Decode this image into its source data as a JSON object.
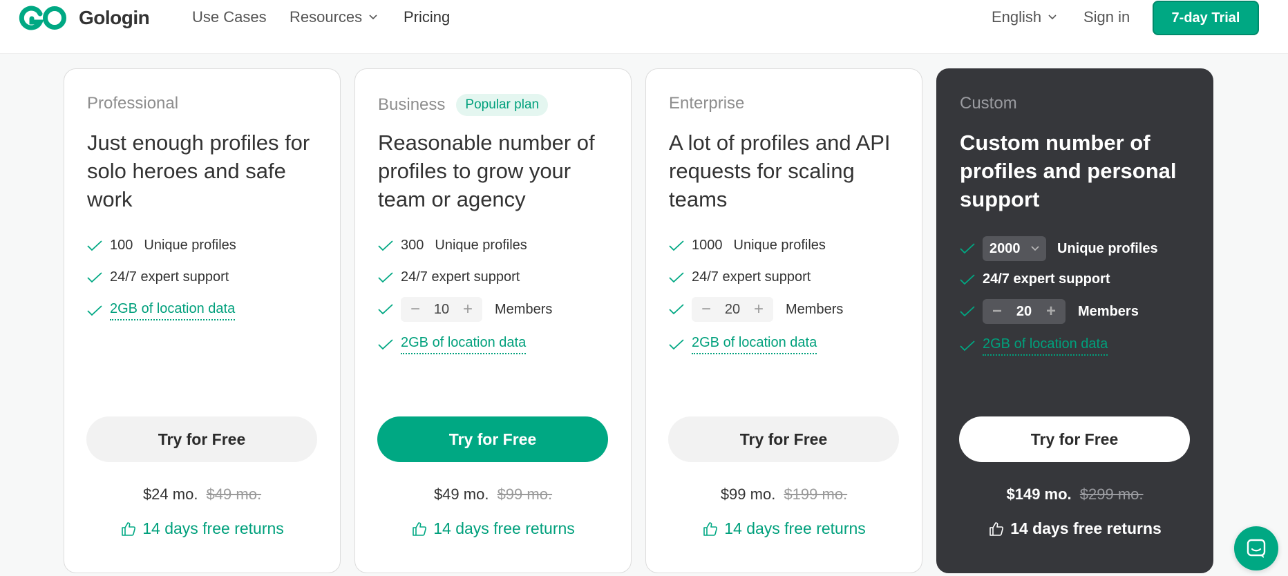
{
  "brand": {
    "name": "Gologin",
    "accent": "#00a883",
    "dark_card": "#36373b"
  },
  "nav": {
    "items": [
      {
        "label": "Use Cases",
        "dropdown": false
      },
      {
        "label": "Resources",
        "dropdown": true
      },
      {
        "label": "Pricing",
        "dropdown": false
      }
    ],
    "language": "English",
    "sign_in": "Sign in",
    "trial_button": "7-day Trial"
  },
  "plans": [
    {
      "name": "Professional",
      "badge": "",
      "description": "Just enough profiles for solo heroes and safe work",
      "profiles": "100",
      "profiles_label": "Unique profiles",
      "support": "24/7 expert support",
      "members": null,
      "members_label": "",
      "location": "2GB of location data",
      "cta": "Try for Free",
      "price": "$24 mo.",
      "old_price": "$49 mo.",
      "returns": "14 days free returns"
    },
    {
      "name": "Business",
      "badge": "Popular plan",
      "description": "Reasonable number of profiles to grow your team or agency",
      "profiles": "300",
      "profiles_label": "Unique profiles",
      "support": "24/7 expert support",
      "members": "10",
      "members_label": "Members",
      "location": "2GB of location data",
      "cta": "Try for Free",
      "price": "$49 mo.",
      "old_price": "$99 mo.",
      "returns": "14 days free returns"
    },
    {
      "name": "Enterprise",
      "badge": "",
      "description": "A lot of profiles and API requests for scaling teams",
      "profiles": "1000",
      "profiles_label": "Unique profiles",
      "support": "24/7 expert support",
      "members": "20",
      "members_label": "Members",
      "location": "2GB of location data",
      "cta": "Try for Free",
      "price": "$99 mo.",
      "old_price": "$199 mo.",
      "returns": "14 days free returns"
    },
    {
      "name": "Custom",
      "badge": "",
      "description": "Custom number of profiles and personal support",
      "profiles": "2000",
      "profiles_label": "Unique profiles",
      "support": "24/7 expert support",
      "members": "20",
      "members_label": "Members",
      "location": "2GB of location data",
      "cta": "Try for Free",
      "price": "$149 mo.",
      "old_price": "$299 mo.",
      "returns": "14 days free returns"
    }
  ],
  "icons": {
    "check": "check-icon",
    "thumb": "thumbs-up-icon",
    "chat": "chat-icon",
    "chevron": "chevron-down-icon"
  }
}
